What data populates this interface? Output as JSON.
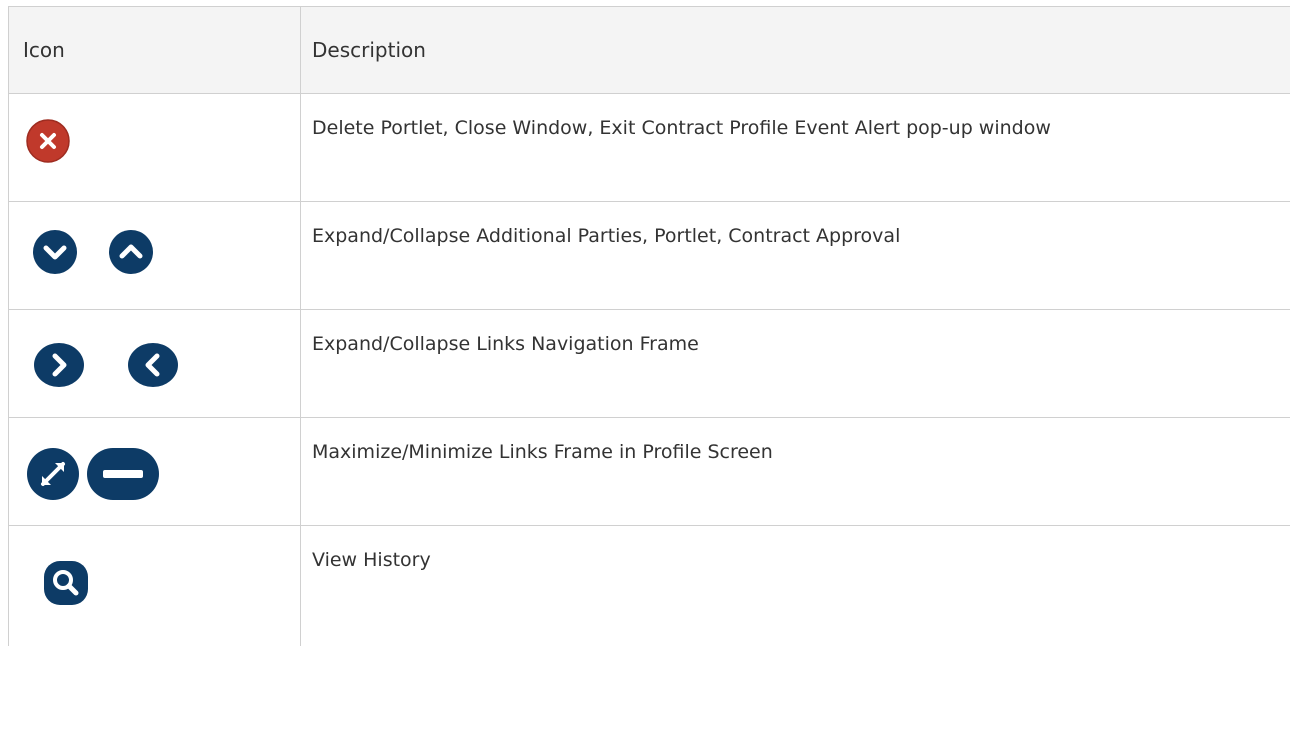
{
  "table": {
    "headers": {
      "icon": "Icon",
      "description": "Description"
    },
    "rows": [
      {
        "icons": [
          "close-icon"
        ],
        "description": "Delete Portlet, Close Window, Exit Contract Profile Event Alert pop-up window"
      },
      {
        "icons": [
          "chevron-down-icon",
          "chevron-up-icon"
        ],
        "description": "Expand/Collapse Additional Parties, Portlet, Contract Approval"
      },
      {
        "icons": [
          "chevron-right-icon",
          "chevron-left-icon"
        ],
        "description": "Expand/Collapse Links Navigation Frame"
      },
      {
        "icons": [
          "maximize-icon",
          "minimize-icon"
        ],
        "description": "Maximize/Minimize Links Frame in Profile Screen"
      },
      {
        "icons": [
          "search-icon"
        ],
        "description": "View History"
      }
    ]
  },
  "colors": {
    "icon_navy": "#0d3b66",
    "icon_red": "#c0392b",
    "header_bg": "#f4f4f4",
    "border": "#d0d0d0",
    "text": "#333333"
  }
}
